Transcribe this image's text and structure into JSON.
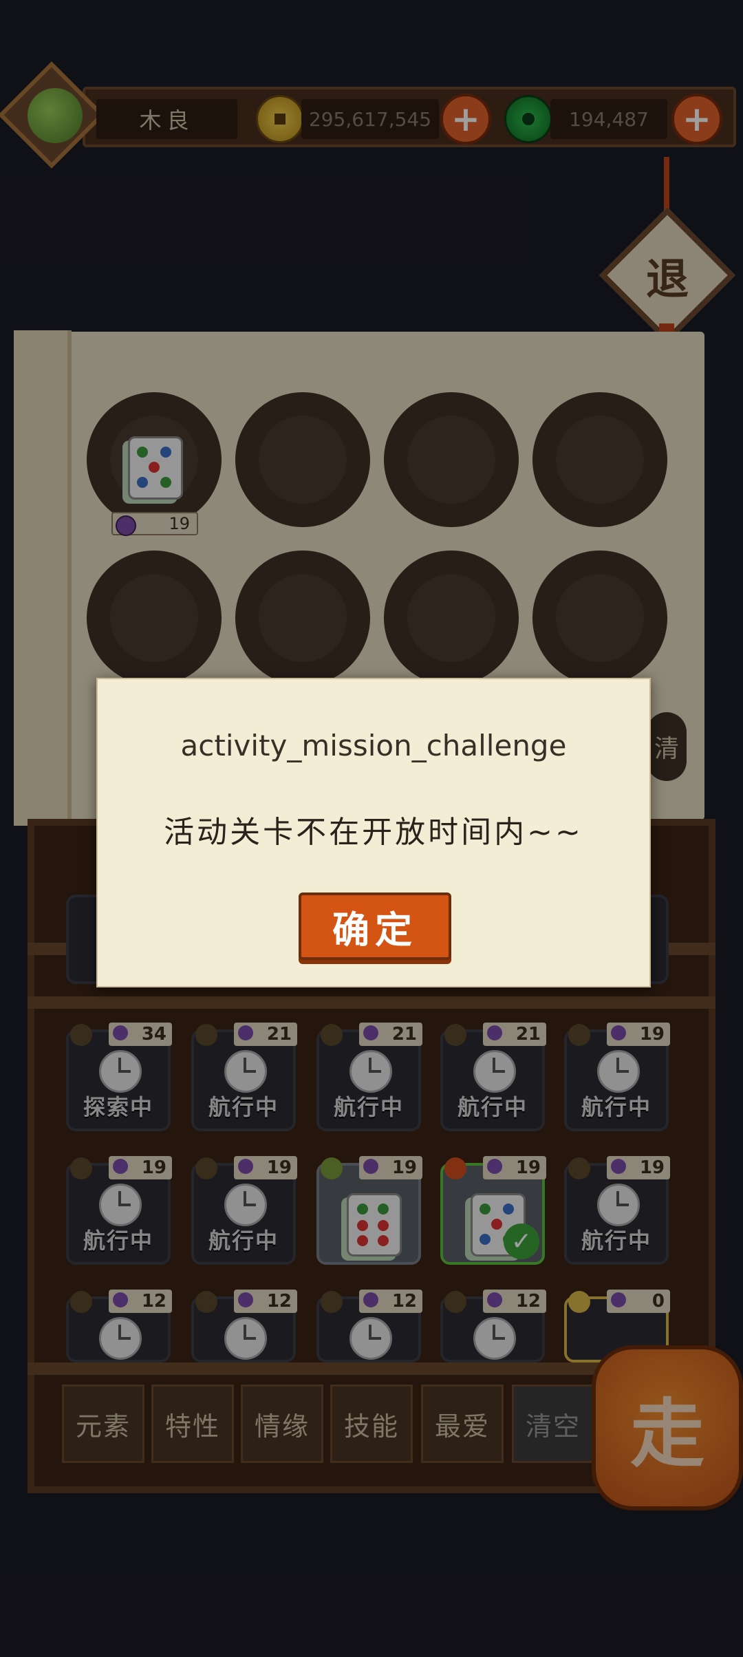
{
  "player": {
    "name": "木良"
  },
  "currency": {
    "gold_amount": "295,617,545",
    "jade_amount": "194,487"
  },
  "exit_label": "退",
  "side_label": "清",
  "collection": {
    "first_slot_badge": "19"
  },
  "cards_row1": [
    {
      "count": "34",
      "status": "探索中"
    },
    {
      "count": "21",
      "status": "航行中"
    },
    {
      "count": "21",
      "status": "航行中"
    },
    {
      "count": "21",
      "status": "航行中"
    },
    {
      "count": "19",
      "status": "航行中"
    }
  ],
  "cards_row2": [
    {
      "count": "19",
      "status": "航行中"
    },
    {
      "count": "19",
      "status": "航行中"
    },
    {
      "count": "19",
      "status": ""
    },
    {
      "count": "19",
      "status": ""
    },
    {
      "count": "19",
      "status": "航行中"
    }
  ],
  "cards_row3": [
    {
      "count": "12"
    },
    {
      "count": "12"
    },
    {
      "count": "12"
    },
    {
      "count": "12"
    },
    {
      "count": "0"
    }
  ],
  "filters": {
    "element": "元素",
    "trait": "特性",
    "bond": "情缘",
    "skill": "技能",
    "favorite": "最爱",
    "clear": "清空"
  },
  "go_label": "走",
  "dialog": {
    "title": "activity_mission_challenge",
    "message": "活动关卡不在开放时间内~~",
    "confirm_label": "确定"
  }
}
